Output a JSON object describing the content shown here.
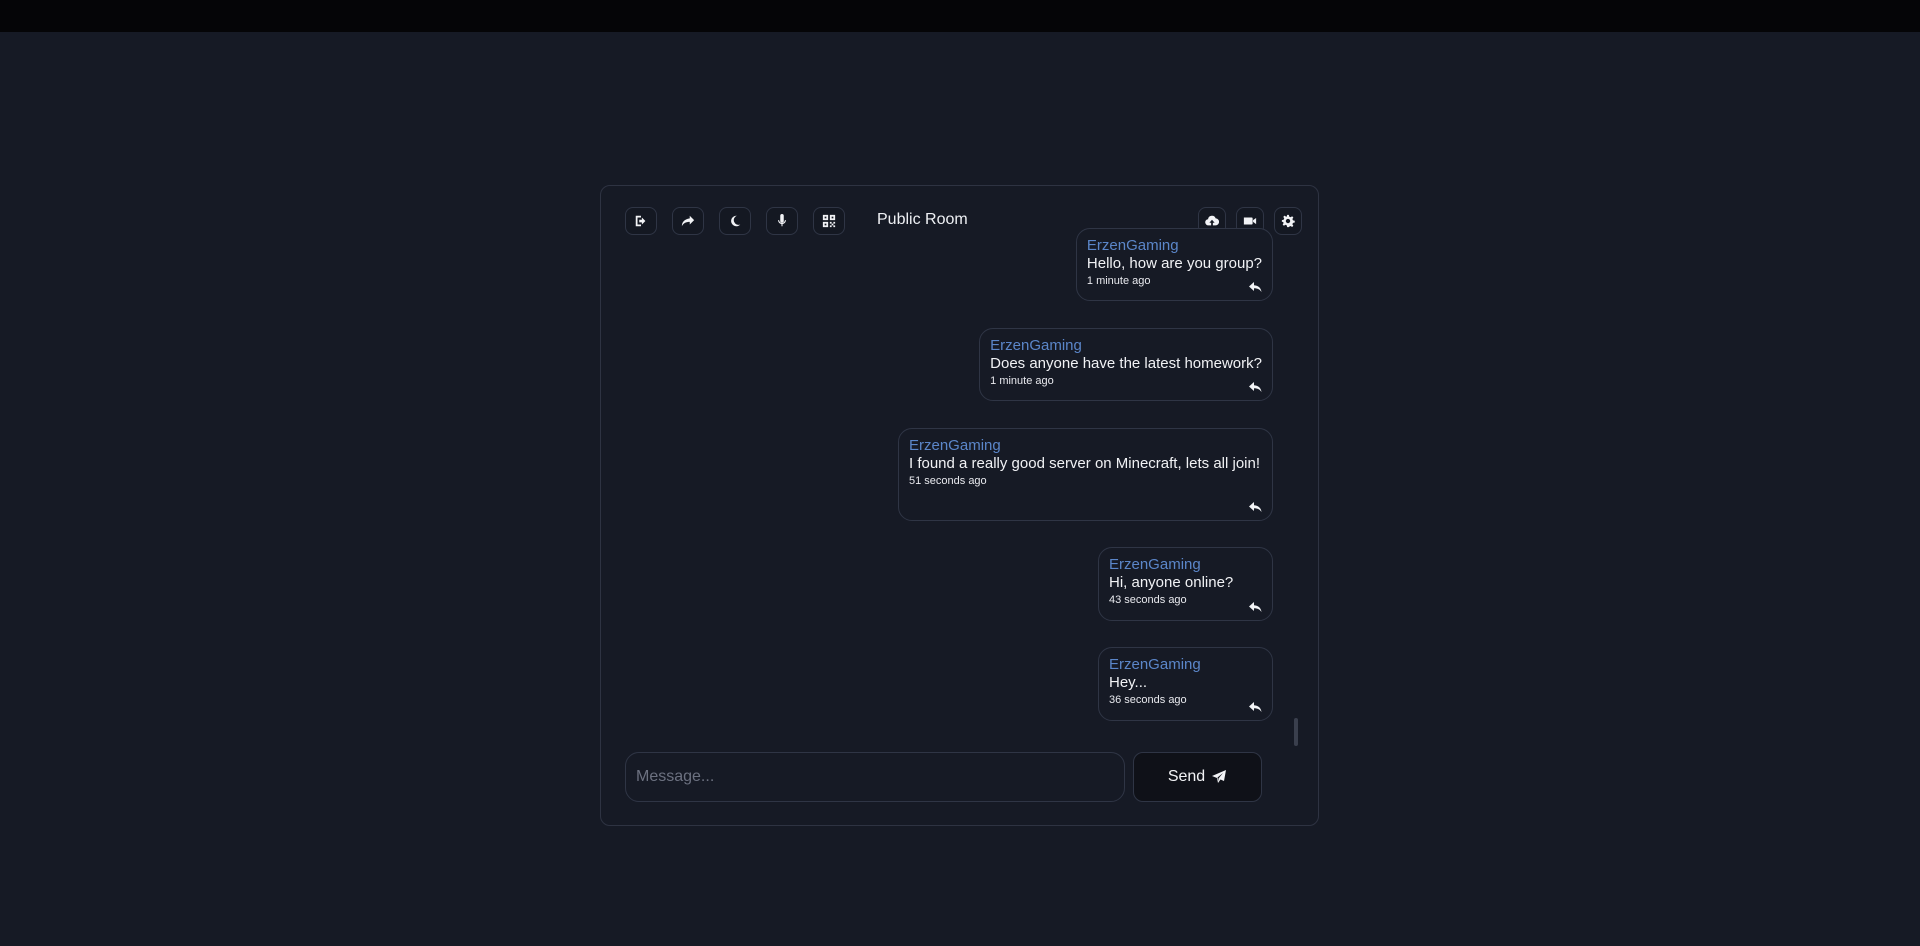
{
  "header": {
    "room_title": "Public Room",
    "left_icons": [
      "logout-icon",
      "share-icon",
      "moon-icon",
      "microphone-icon",
      "qr-code-icon"
    ],
    "right_icons": [
      "cloud-upload-icon",
      "video-camera-icon",
      "gear-icon"
    ]
  },
  "messages": [
    {
      "author": "ErzenGaming",
      "text": "Hello, how are you group?",
      "time": "1 minute ago"
    },
    {
      "author": "ErzenGaming",
      "text": "Does anyone have the latest homework?",
      "time": "1 minute ago"
    },
    {
      "author": "ErzenGaming",
      "text": "I found a really good server on Minecraft, lets all join!",
      "time": "51 seconds ago"
    },
    {
      "author": "ErzenGaming",
      "text": "Hi, anyone online?",
      "time": "43 seconds ago"
    },
    {
      "author": "ErzenGaming",
      "text": "Hey...",
      "time": "36 seconds ago"
    }
  ],
  "composer": {
    "placeholder": "Message...",
    "value": "",
    "send_label": "Send"
  },
  "colors": {
    "background": "#161a25",
    "author": "#5b86c9",
    "border": "#2f3545"
  }
}
